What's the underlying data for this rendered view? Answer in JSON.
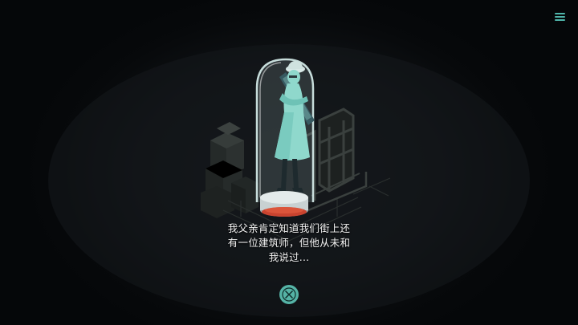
{
  "dialogue": {
    "lines": [
      "我父亲肯定知道我们街上还",
      "有一位建筑师，但他从未和",
      "我说过..."
    ]
  },
  "controls": {
    "menu_icon": "hamburger-menu-icon",
    "close_icon": "close-x-icon"
  },
  "colors": {
    "accent": "#55b3a6",
    "background": "#050709",
    "statue": "#8fd8cc",
    "glass": "#d9f1ee",
    "pedestal_ring": "#c9432f"
  }
}
